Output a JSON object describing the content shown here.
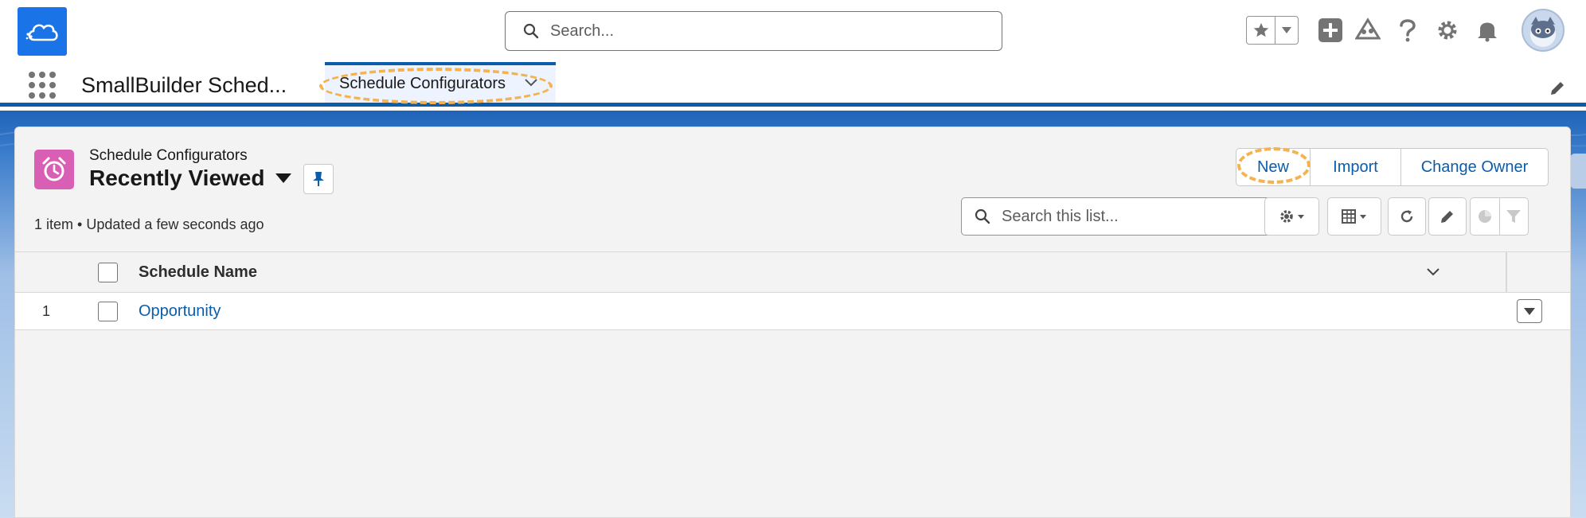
{
  "global_header": {
    "search_placeholder": "Search...",
    "icons": [
      "cloud-logo-icon",
      "star-icon",
      "chevron-down-icon",
      "plus-icon",
      "trailhead-icon",
      "help-icon",
      "gear-icon",
      "bell-icon",
      "avatar"
    ]
  },
  "nav": {
    "app_name": "SmallBuilder Sched...",
    "active_tab": "Schedule Configurators"
  },
  "list_view": {
    "object_label": "Schedule Configurators",
    "title": "Recently Viewed",
    "meta": "1 item • Updated a few seconds ago",
    "actions": [
      "New",
      "Import",
      "Change Owner"
    ],
    "search_placeholder": "Search this list..."
  },
  "table": {
    "columns": [
      "Schedule Name"
    ],
    "rows": [
      {
        "number": "1",
        "name": "Opportunity"
      }
    ]
  },
  "colors": {
    "brand_blue": "#0b5cab",
    "logo_blue": "#1b73e8",
    "object_icon_pink": "#d95fb5",
    "highlight_orange": "#f4b350"
  }
}
